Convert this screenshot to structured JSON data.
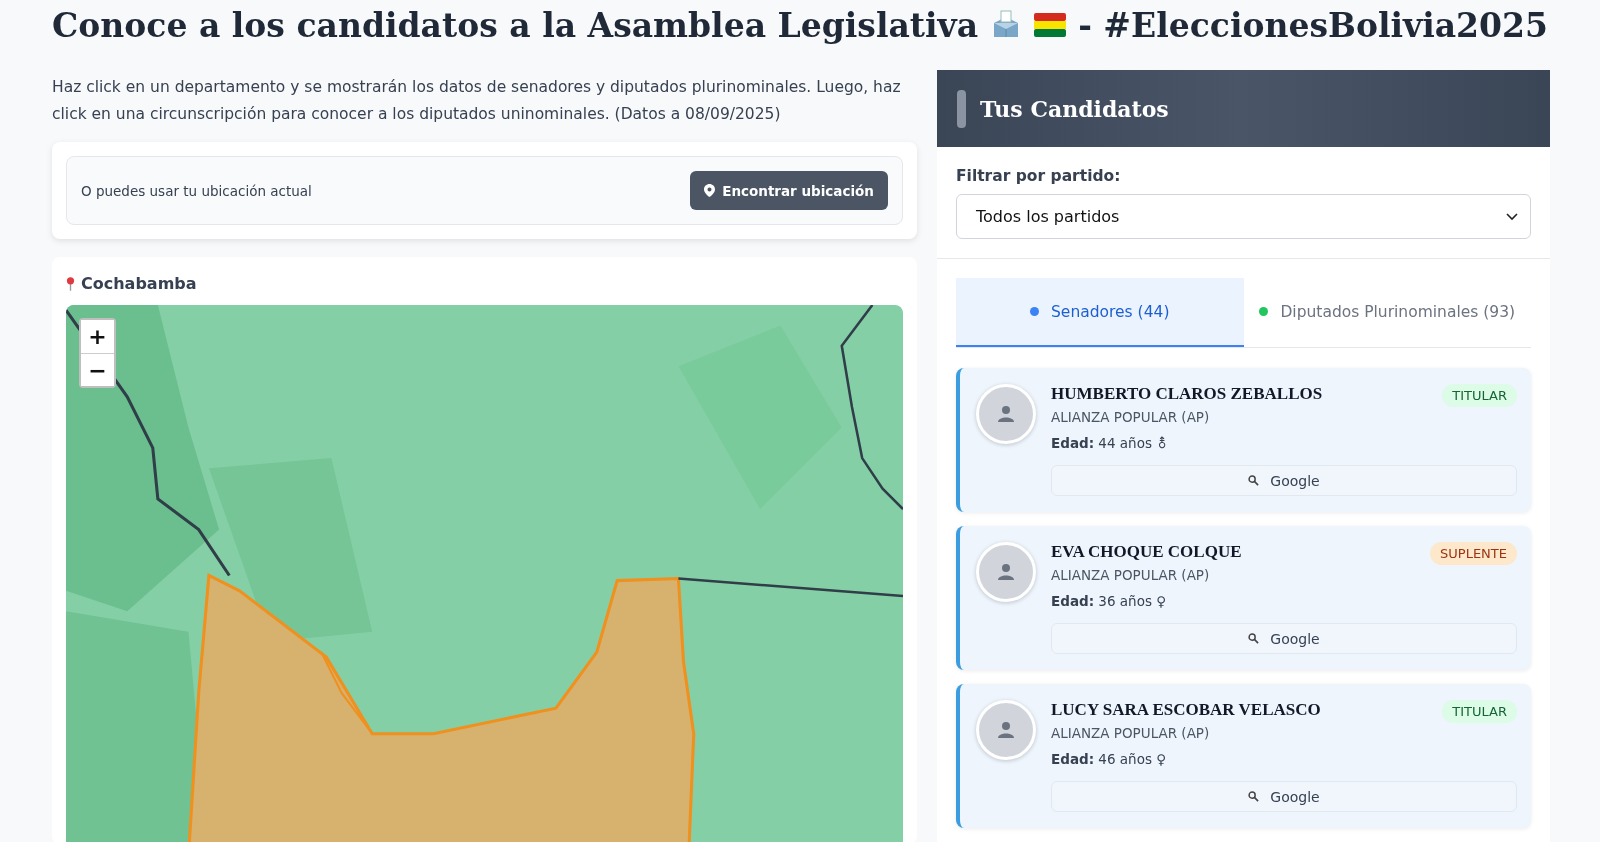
{
  "title": {
    "before": "Conoce a los candidatos a la Asamblea Legislativa",
    "after": "- #EleccionesBolivia2025"
  },
  "intro": "Haz click en un departamento y se mostrarán los datos de senadores y diputados plurinominales. Luego, haz click en una circunscripción para conocer a los diputados uninominales. (Datos a 08/09/2025)",
  "location": {
    "text": "O puedes usar tu ubicación actual",
    "button": "Encontrar ubicación"
  },
  "map_panel": {
    "department": "Cochabamba",
    "zoom_in": "+",
    "zoom_out": "−"
  },
  "sidebar": {
    "title": "Tus Candidatos",
    "filter_label": "Filtrar por partido:",
    "filter_value": "Todos los partidos",
    "tabs": [
      {
        "label": "Senadores (44)",
        "selected": true,
        "color": "#3b82f6"
      },
      {
        "label": "Diputados Plurinominales (93)",
        "selected": false,
        "color": "#22c55e"
      }
    ],
    "candidates": [
      {
        "name": "HUMBERTO CLAROS ZEBALLOS",
        "party": "ALIANZA POPULAR (AP)",
        "age": "**Edad:** 44 años ⚨",
        "role": "TITULAR",
        "kind": "titular",
        "search": "Google"
      },
      {
        "name": "EVA CHOQUE COLQUE",
        "party": "ALIANZA POPULAR (AP)",
        "age": "**Edad:** 36 años ♀",
        "role": "SUPLENTE",
        "kind": "suplente",
        "search": "Google"
      },
      {
        "name": "LUCY SARA ESCOBAR VELASCO",
        "party": "ALIANZA POPULAR (AP)",
        "age": "**Edad:** 46 años ♀",
        "role": "TITULAR",
        "kind": "titular",
        "search": "Google"
      }
    ]
  }
}
